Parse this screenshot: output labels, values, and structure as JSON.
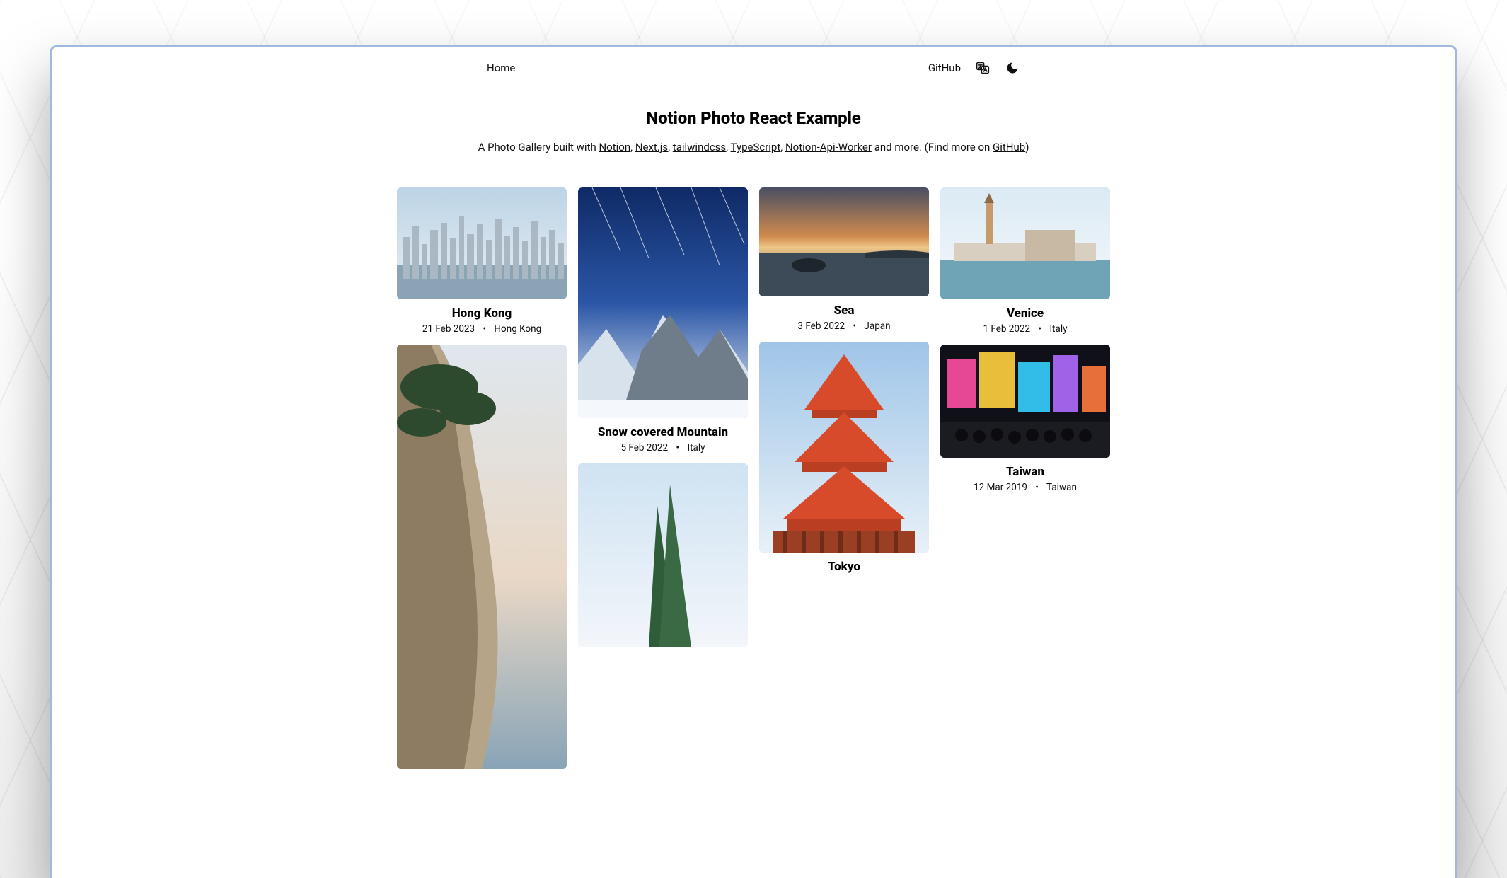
{
  "nav": {
    "home": "Home",
    "github": "GitHub"
  },
  "hero": {
    "title": "Notion Photo React Example",
    "prefix": "A Photo Gallery built with ",
    "links": [
      "Notion",
      "Next.js",
      "tailwindcss",
      "TypeScript",
      "Notion-Api-Worker"
    ],
    "mid": " and more. (Find more on ",
    "github": "GitHub",
    "suffix": ")"
  },
  "cards": {
    "hk": {
      "title": "Hong Kong",
      "date": "21 Feb 2023",
      "location": "Hong Kong"
    },
    "snow": {
      "title": "Snow covered Mountain",
      "date": "5 Feb 2022",
      "location": "Italy"
    },
    "sea": {
      "title": "Sea",
      "date": "3 Feb 2022",
      "location": "Japan"
    },
    "tokyo": {
      "title": "Tokyo",
      "date": "",
      "location": ""
    },
    "venice": {
      "title": "Venice",
      "date": "1 Feb 2022",
      "location": "Italy"
    },
    "taiwan": {
      "title": "Taiwan",
      "date": "12 Mar 2019",
      "location": "Taiwan"
    }
  },
  "sep": "•"
}
